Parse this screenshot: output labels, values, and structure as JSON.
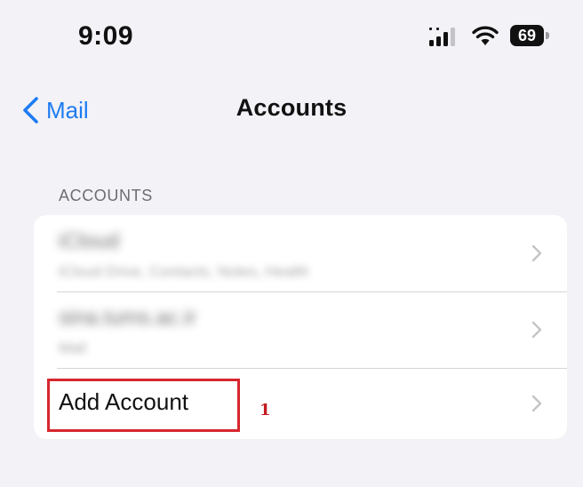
{
  "status_bar": {
    "time": "9:09",
    "battery_level": "69",
    "icons": [
      "cellular-signal-icon",
      "wifi-icon",
      "battery-icon"
    ]
  },
  "nav": {
    "back_label": "Mail",
    "title": "Accounts"
  },
  "section": {
    "header": "ACCOUNTS"
  },
  "accounts": [
    {
      "title": "iCloud",
      "subtitle": "iCloud Drive, Contacts, Notes, Health",
      "blurred": true
    },
    {
      "title": "sina.tums.ac.ir",
      "subtitle": "Mail",
      "blurred": true
    }
  ],
  "add_account": {
    "label": "Add Account"
  },
  "annotation": {
    "step": "1",
    "color": "#d7262e"
  },
  "colors": {
    "accent": "#1e7cf2",
    "background": "#f2f2f7",
    "card": "#ffffff"
  }
}
